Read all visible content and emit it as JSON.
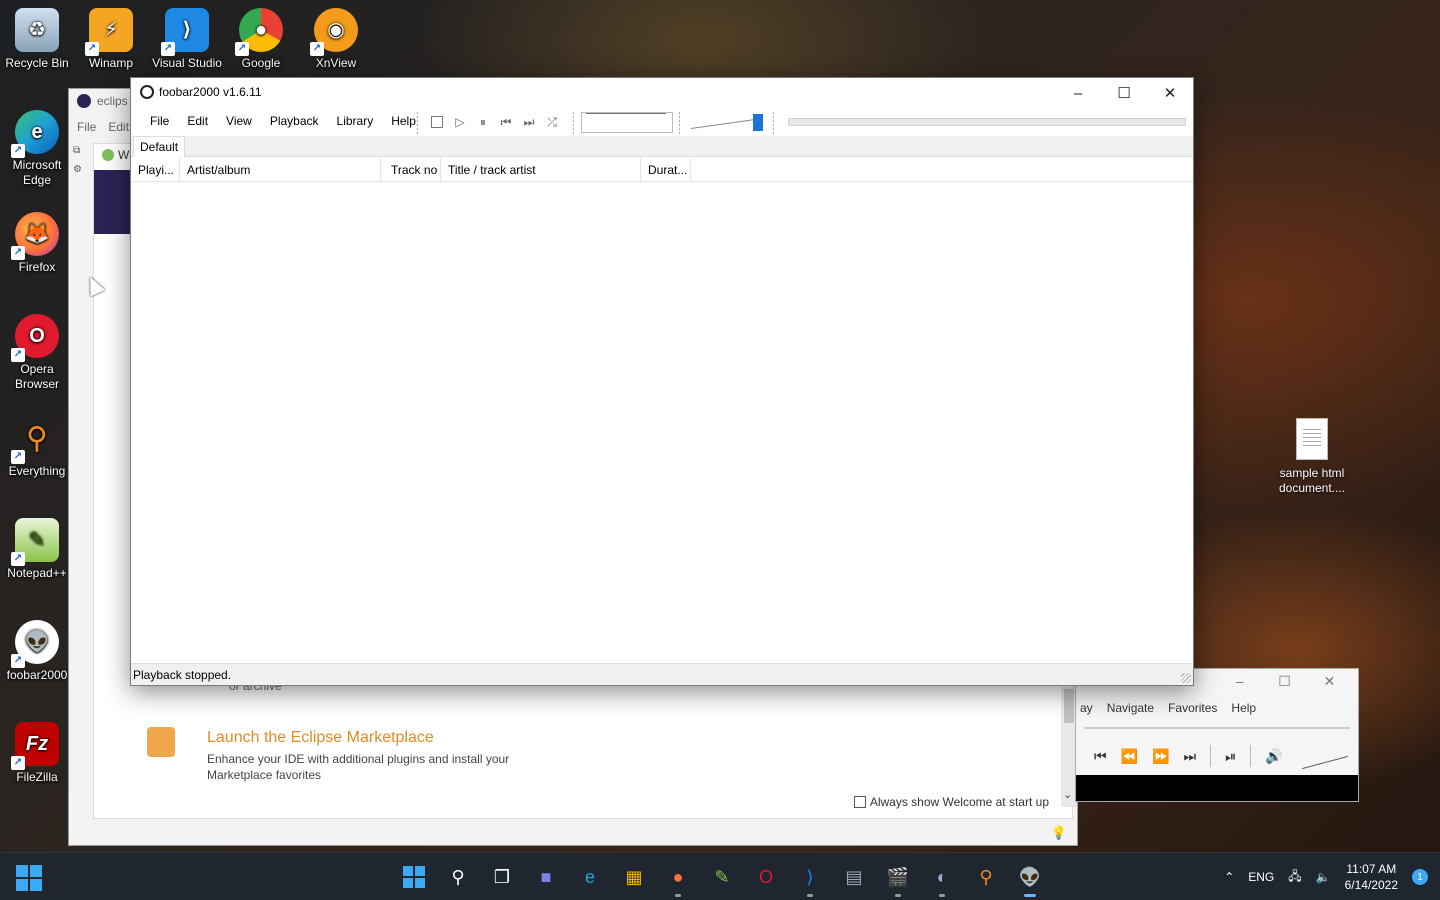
{
  "desktop": {
    "icons": [
      {
        "label": "Recycle Bin",
        "icon": "recycle-bin-icon",
        "color": "#9fb4c8"
      },
      {
        "label": "Winamp",
        "icon": "winamp-icon",
        "color": "#f4a522"
      },
      {
        "label": "Visual Studio",
        "icon": "vscode-icon",
        "color": "#1e88e5"
      },
      {
        "label": "Google",
        "icon": "chrome-icon",
        "color": "#e94235"
      },
      {
        "label": "XnView",
        "icon": "xnview-icon",
        "color": "#f59b1b"
      },
      {
        "label": "Microsoft Edge",
        "icon": "edge-icon",
        "color": "#1fa0d8"
      },
      {
        "label": "Firefox",
        "icon": "firefox-icon",
        "color": "#ff7139"
      },
      {
        "label": "Opera Browser",
        "icon": "opera-icon",
        "color": "#e0192d"
      },
      {
        "label": "Everything",
        "icon": "everything-icon",
        "color": "#f08a1c"
      },
      {
        "label": "Notepad++",
        "icon": "notepadpp-icon",
        "color": "#8ac44a"
      },
      {
        "label": "foobar2000",
        "icon": "foobar2000-icon",
        "color": "#222222"
      },
      {
        "label": "FileZilla",
        "icon": "filezilla-icon",
        "color": "#bf0000"
      }
    ],
    "sample_doc_label": "sample html document...."
  },
  "eclipse": {
    "title": "eclips",
    "menu": [
      "File",
      "Edit"
    ],
    "tab_label": "W",
    "cutoff_text": "or archive",
    "market_title": "Launch the Eclipse Marketplace",
    "market_desc": "Enhance your IDE with additional plugins and install your Marketplace favorites",
    "always_show": "Always show Welcome at start up"
  },
  "media_player": {
    "menu": [
      "ay",
      "Navigate",
      "Favorites",
      "Help"
    ]
  },
  "foobar": {
    "title": "foobar2000 v1.6.11",
    "menu": [
      "File",
      "Edit",
      "View",
      "Playback",
      "Library",
      "Help"
    ],
    "playlist_tab": "Default",
    "columns": [
      "Playi...",
      "Artist/album",
      "Track no",
      "Title / track artist",
      "Durat..."
    ],
    "status": "Playback stopped.",
    "volume_level": 1.0
  },
  "taskbar": {
    "lang": "ENG",
    "time": "11:07 AM",
    "date": "6/14/2022",
    "notifications": "1",
    "accent": "#3da8f4"
  }
}
